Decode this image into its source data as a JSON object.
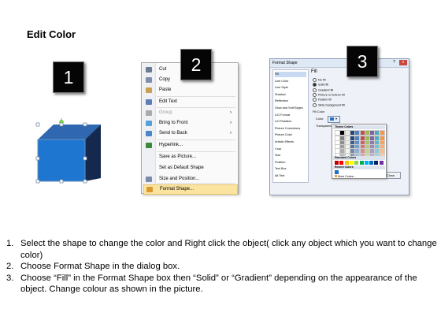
{
  "title": "Edit Color",
  "steps": [
    "1",
    "2",
    "3"
  ],
  "context_menu": {
    "items": [
      {
        "label": "Cut",
        "icon": "scissors-icon"
      },
      {
        "label": "Copy",
        "icon": "copy-icon"
      },
      {
        "label": "Paste",
        "icon": "paste-icon"
      },
      {
        "label": "Edit Text",
        "icon": "edit-text-icon"
      },
      {
        "label": "Group",
        "icon": "group-icon",
        "disabled": true,
        "submenu": true
      },
      {
        "label": "Bring to Front",
        "icon": "bring-front-icon",
        "submenu": true
      },
      {
        "label": "Send to Back",
        "icon": "send-back-icon",
        "submenu": true
      },
      {
        "label": "Hyperlink...",
        "icon": "hyperlink-icon"
      },
      {
        "label": "Save as Picture...",
        "icon": ""
      },
      {
        "label": "Set as Default Shape",
        "icon": ""
      },
      {
        "label": "Size and Position...",
        "icon": "size-position-icon"
      },
      {
        "label": "Format Shape...",
        "icon": "format-shape-icon",
        "highlighted": true
      }
    ]
  },
  "dialog": {
    "title": "Format Shape",
    "help": "?",
    "close_x": "x",
    "nav": [
      "Fill",
      "Line Color",
      "Line Style",
      "Shadow",
      "Reflection",
      "Glow and Soft Edges",
      "3-D Format",
      "3-D Rotation",
      "Picture Corrections",
      "Picture Color",
      "Artistic Effects",
      "Crop",
      "Size",
      "Position",
      "Text Box",
      "Alt Text"
    ],
    "panel_title": "Fill",
    "fill_options": [
      "No fill",
      "Solid fill",
      "Gradient fill",
      "Picture or texture fill",
      "Pattern fill",
      "Slide background fill"
    ],
    "fill_color_label": "Fill Color",
    "color_label": "Color:",
    "transparency_label": "Transparency:",
    "theme_colors": "Theme Colors",
    "standard_colors": "Standard Colors",
    "recent_colors": "Recent Colors",
    "more_colors": "More Colors...",
    "close_button": "Close"
  },
  "instructions": [
    {
      "num": "1.",
      "text": "Select the shape to change the color and Right click the object( click any object which you want to change color)"
    },
    {
      "num": "2.",
      "text": "Choose Format Shape in the dialog box."
    },
    {
      "num": "3.",
      "text": "Choose “Fill” in the Format Shape box then “Solid” or “Gradient” depending on the appearance of the object. Change colour as shown in the picture."
    }
  ]
}
